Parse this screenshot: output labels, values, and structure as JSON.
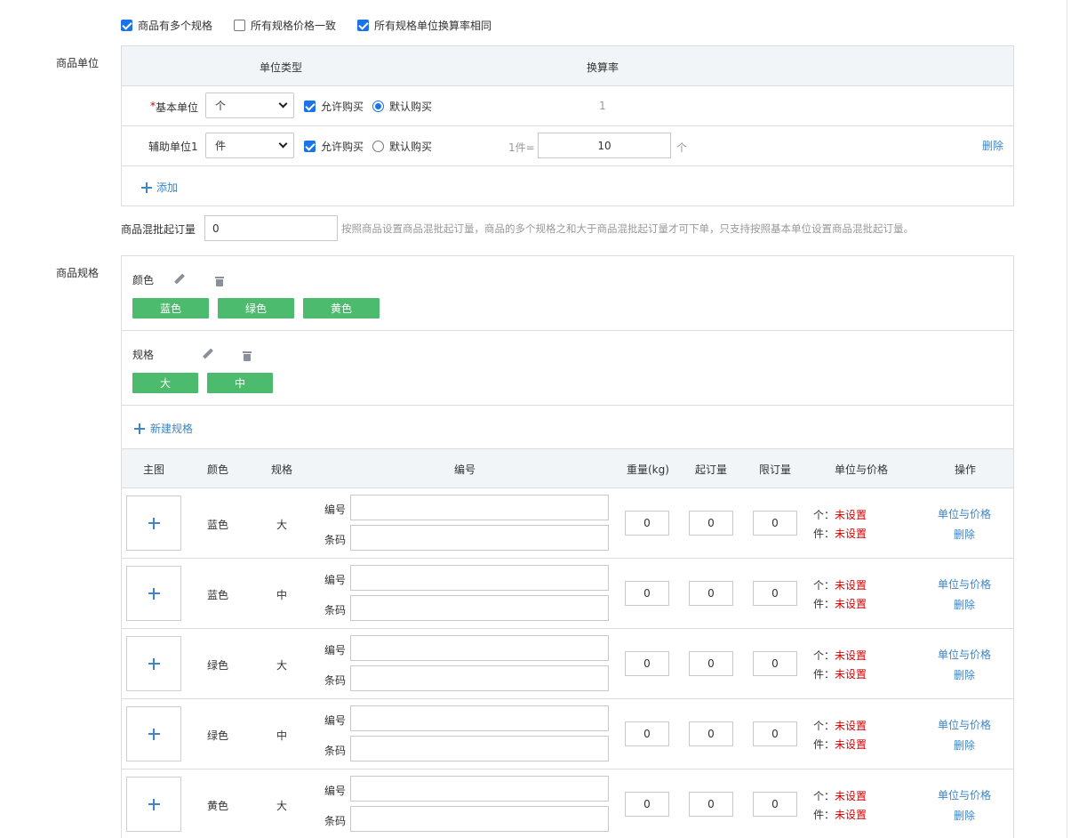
{
  "top_options": [
    {
      "label": "商品有多个规格",
      "checked": true
    },
    {
      "label": "所有规格价格一致",
      "checked": false
    },
    {
      "label": "所有规格单位换算率相同",
      "checked": true
    }
  ],
  "units": {
    "section_label": "商品单位",
    "header": {
      "unit_type": "单位类型",
      "rate": "换算率"
    },
    "base": {
      "required_mark": "*",
      "label": "基本单位",
      "value": "个",
      "allow_label": "允许购买",
      "allow_checked": true,
      "default_label": "默认购买",
      "default_selected": true,
      "rate": "1"
    },
    "aux": {
      "label": "辅助单位1",
      "value": "件",
      "allow_label": "允许购买",
      "allow_checked": true,
      "default_label": "默认购买",
      "default_selected": false,
      "rate_prefix": "1件=",
      "rate_value": "10",
      "rate_suffix": "个",
      "delete_label": "删除"
    },
    "add_label": "添加"
  },
  "mixed_batch": {
    "label": "商品混批起订量",
    "value": "0",
    "hint": "按照商品设置商品混批起订量，商品的多个规格之和大于商品混批起订量才可下单，只支持按照基本单位设置商品混批起订量。"
  },
  "specs": {
    "section_label": "商品规格",
    "groups": [
      {
        "name": "颜色",
        "values": [
          "蓝色",
          "绿色",
          "黄色"
        ]
      },
      {
        "name": "规格",
        "values": [
          "大",
          "中"
        ]
      }
    ],
    "new_spec_label": "新建规格"
  },
  "sku_table": {
    "headers": {
      "image": "主图",
      "color": "颜色",
      "size": "规格",
      "code": "编号",
      "weight": "重量(kg)",
      "min_order": "起订量",
      "max_order": "限订量",
      "unit_price": "单位与价格",
      "actions": "操作"
    },
    "code_label": "编号",
    "barcode_label": "条码",
    "unit_labels": [
      "个：",
      "件："
    ],
    "unset_text": "未设置",
    "action_price": "单位与价格",
    "action_delete": "删除",
    "rows": [
      {
        "color": "蓝色",
        "size": "大",
        "code": "",
        "barcode": "",
        "weight": "0",
        "min_order": "0",
        "max_order": "0"
      },
      {
        "color": "蓝色",
        "size": "中",
        "code": "",
        "barcode": "",
        "weight": "0",
        "min_order": "0",
        "max_order": "0"
      },
      {
        "color": "绿色",
        "size": "大",
        "code": "",
        "barcode": "",
        "weight": "0",
        "min_order": "0",
        "max_order": "0"
      },
      {
        "color": "绿色",
        "size": "中",
        "code": "",
        "barcode": "",
        "weight": "0",
        "min_order": "0",
        "max_order": "0"
      },
      {
        "color": "黄色",
        "size": "大",
        "code": "",
        "barcode": "",
        "weight": "0",
        "min_order": "0",
        "max_order": "0"
      }
    ]
  },
  "colors": {
    "accent": "#1a73e8",
    "link": "#3d85c6",
    "tag_green": "#4dbb6d",
    "unset_red": "#d60000"
  }
}
